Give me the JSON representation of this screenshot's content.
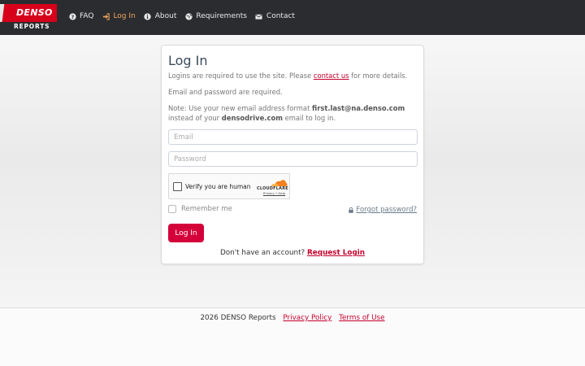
{
  "header": {
    "logo_text": "DENSO",
    "logo_sub": "REPORTS",
    "nav": [
      {
        "label": "FAQ",
        "icon": "question-circle-icon",
        "active": false
      },
      {
        "label": "Log In",
        "icon": "sign-in-icon",
        "active": true
      },
      {
        "label": "About",
        "icon": "info-circle-icon",
        "active": false
      },
      {
        "label": "Requirements",
        "icon": "globe-icon",
        "active": false
      },
      {
        "label": "Contact",
        "icon": "envelope-icon",
        "active": false
      }
    ]
  },
  "login": {
    "title": "Log In",
    "intro_before": "Logins are required to use the site. Please ",
    "intro_link": "contact us",
    "intro_after": " for more details.",
    "required_note": "Email and password are required.",
    "note_line1_before": "Note: Use your new email address format ",
    "note_line1_bold": "first.last@na.denso.com",
    "note_line2_before": "instead of your ",
    "note_line2_bold": "densodrive.com",
    "note_line2_after": " email to log in.",
    "email_placeholder": "Email",
    "email_value": "",
    "password_placeholder": "Password",
    "password_value": "",
    "captcha_label": "Verify you are human",
    "captcha_brand": "CLOUDFLARE",
    "captcha_links": "Privacy • Help",
    "remember_label": "Remember me",
    "forgot_label": "Forgot password?",
    "submit_label": "Log In",
    "no_account_text": "Don't have an account? ",
    "request_link": "Request Login"
  },
  "footer": {
    "copyright": "2026 DENSO Reports",
    "privacy": "Privacy Policy",
    "terms": "Terms of Use"
  },
  "colors": {
    "brand_red": "#d7001a",
    "button_red": "#d4003a",
    "header_bg": "#2b2c2f",
    "nav_active": "#f0a55c"
  }
}
